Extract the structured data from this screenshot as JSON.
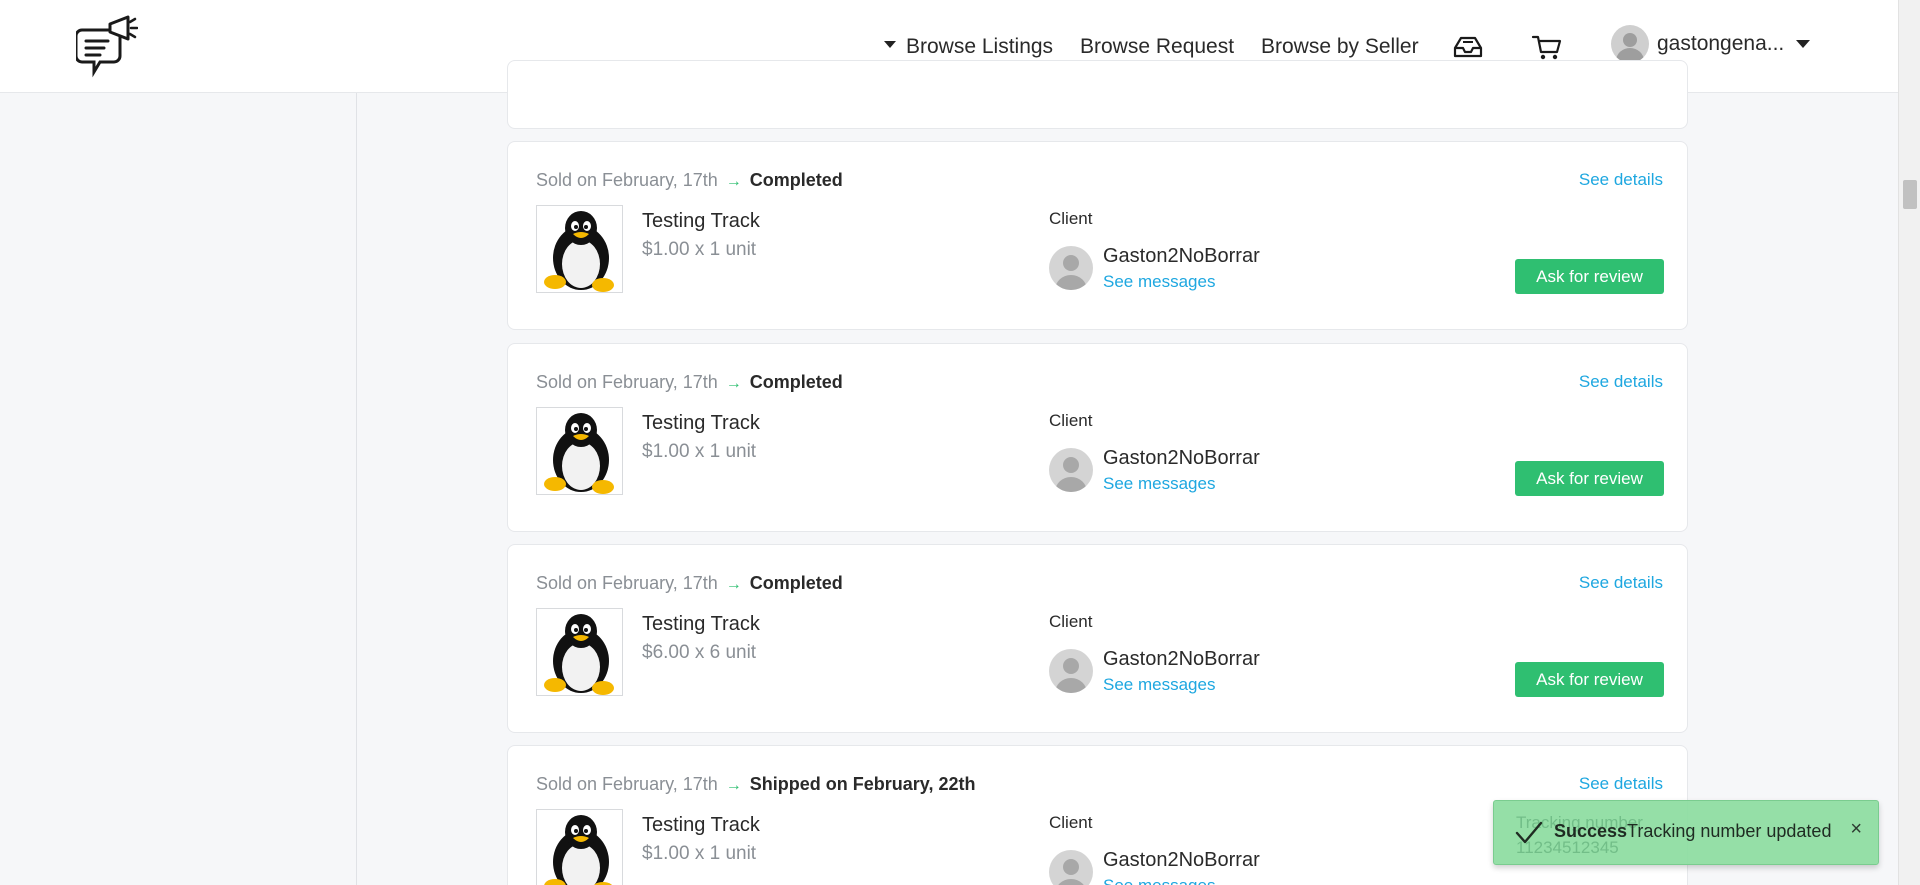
{
  "header": {
    "nav": {
      "browse_listings": "Browse Listings",
      "browse_request": "Browse Request",
      "browse_by_seller": "Browse by Seller"
    },
    "user_name": "gastongena...",
    "icons": {
      "logo": "megaphone-chat-logo",
      "inbox": "inbox-tray-icon",
      "cart": "shopping-cart-icon"
    }
  },
  "orders": [
    {
      "sold": "Sold on February, 17th",
      "status": "Completed",
      "see_details": "See details",
      "title": "Testing Track",
      "price": "$1.00 x 1 unit",
      "client_label": "Client",
      "client_name": "Gaston2NoBorrar",
      "see_messages": "See messages",
      "action": "Ask for review"
    },
    {
      "sold": "Sold on February, 17th",
      "status": "Completed",
      "see_details": "See details",
      "title": "Testing Track",
      "price": "$1.00 x 1 unit",
      "client_label": "Client",
      "client_name": "Gaston2NoBorrar",
      "see_messages": "See messages",
      "action": "Ask for review"
    },
    {
      "sold": "Sold on February, 17th",
      "status": "Completed",
      "see_details": "See details",
      "title": "Testing Track",
      "price": "$6.00 x 6 unit",
      "client_label": "Client",
      "client_name": "Gaston2NoBorrar",
      "see_messages": "See messages",
      "action": "Ask for review"
    },
    {
      "sold": "Sold on February, 17th",
      "status": "Shipped on February, 22th",
      "see_details": "See details",
      "title": "Testing Track",
      "price": "$1.00 x 1 unit",
      "client_label": "Client",
      "client_name": "Gaston2NoBorrar",
      "see_messages": "See messages",
      "tracking_label": "Tracking number",
      "tracking_value": "11234512345"
    }
  ],
  "toast": {
    "title": "Success",
    "message": "Tracking number updated",
    "close": "×"
  },
  "colors": {
    "accent_green": "#2fbf71",
    "link_blue": "#1ea7e0"
  }
}
